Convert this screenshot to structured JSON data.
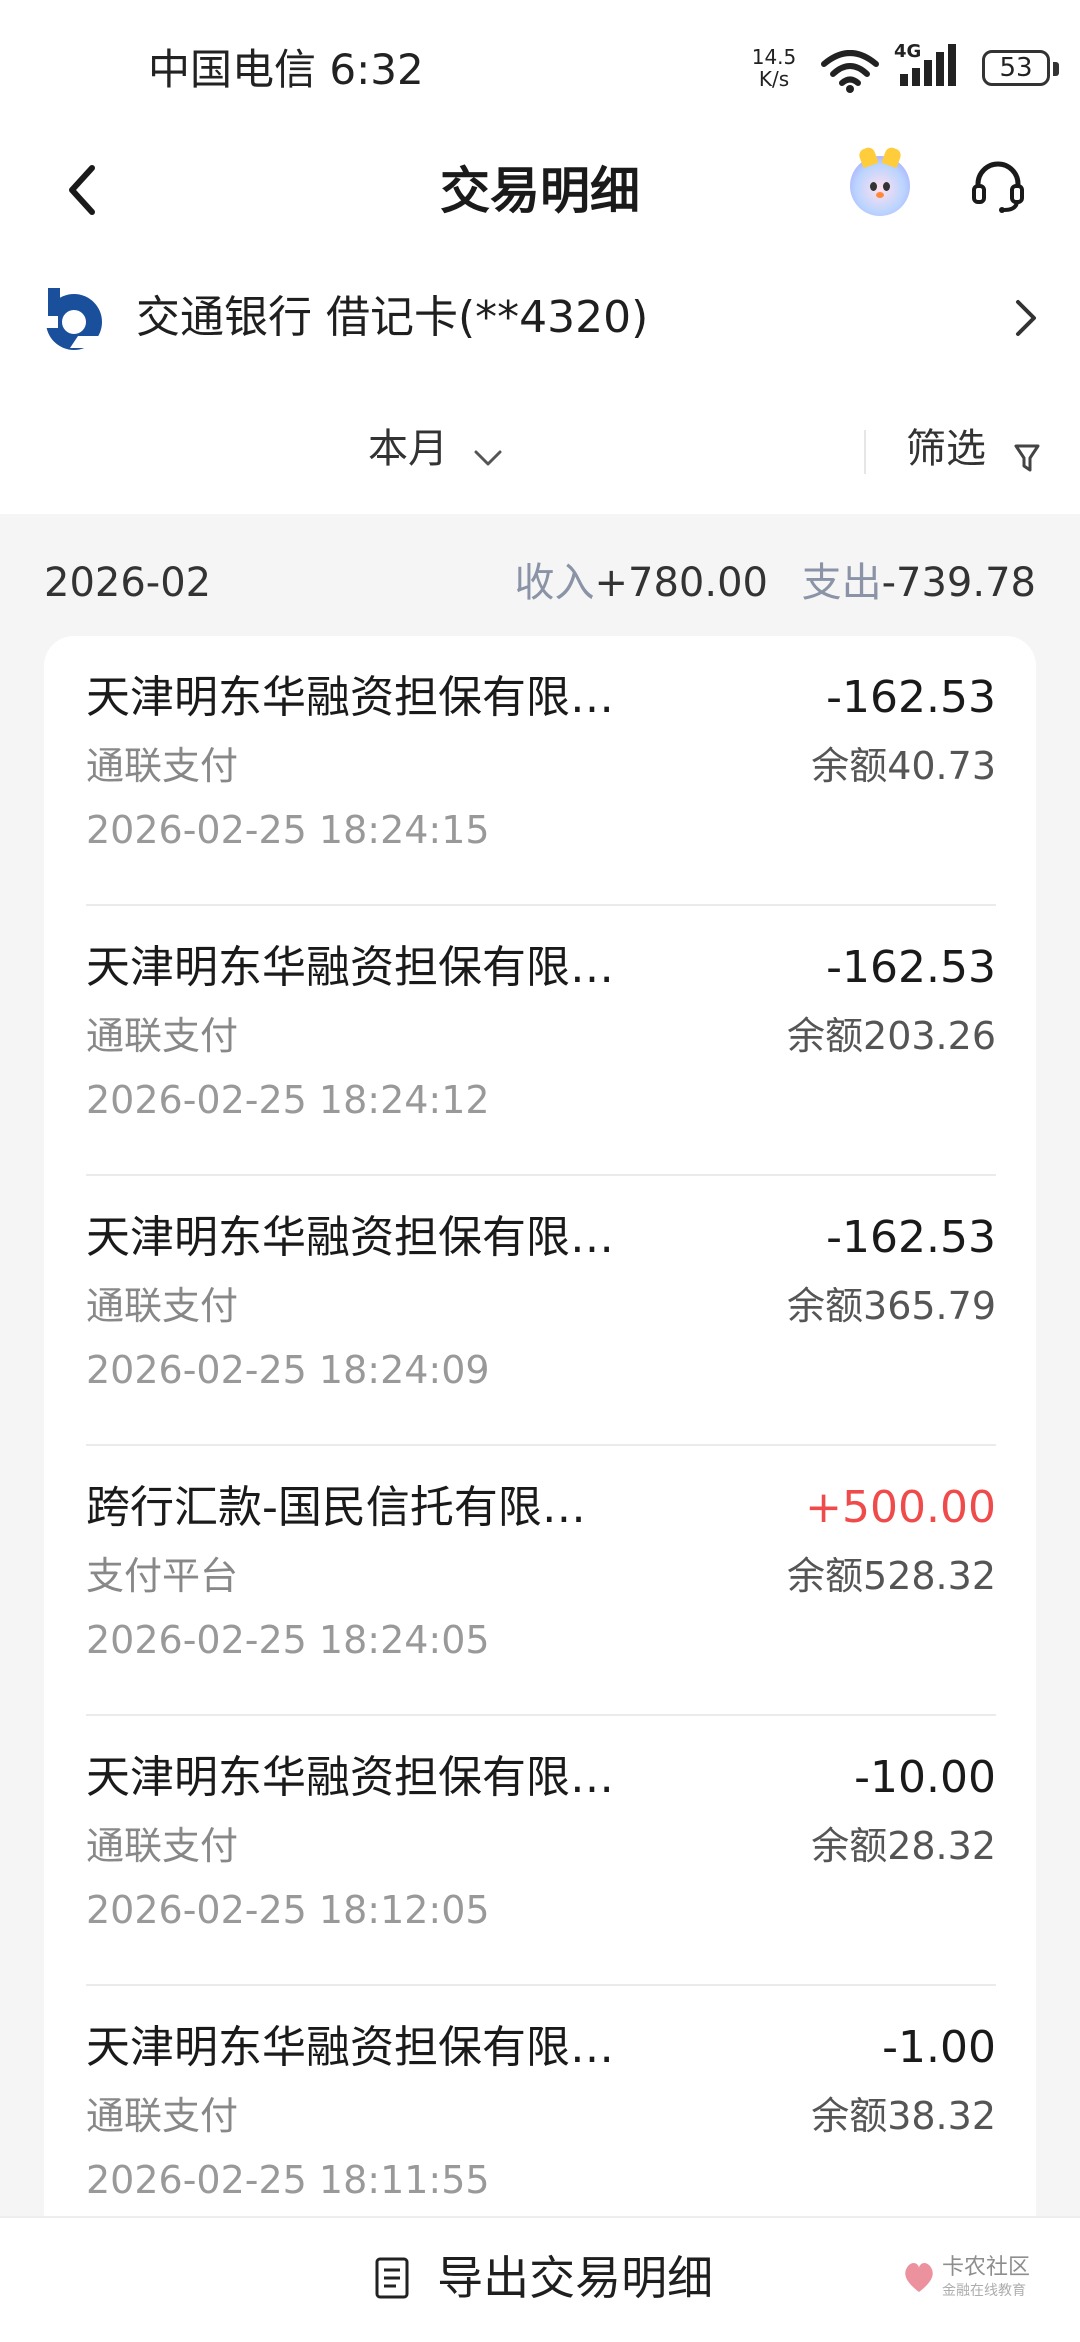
{
  "status_bar": {
    "carrier_time": "中国电信 6:32",
    "net_speed_value": "14.5",
    "net_speed_unit": "K/s",
    "signal_label": "4G",
    "battery": "53"
  },
  "header": {
    "title": "交易明细",
    "back_icon": "chevron-left-icon",
    "service_icon": "headset-icon"
  },
  "card": {
    "name": "交通银行 借记卡(**4320)",
    "brand_color": "#1a4f9c"
  },
  "filter": {
    "period": "本月",
    "filter_label": "筛选"
  },
  "summary": {
    "month": "2026-02",
    "income_label": "收入",
    "income_value": "+780.00",
    "expense_label": "支出",
    "expense_value": "-739.78"
  },
  "transactions": [
    {
      "desc": "天津明东华融资担保有限…",
      "amount": "-162.53",
      "channel": "通联支付",
      "balance": "余额40.73",
      "time": "2026-02-25 18:24:15"
    },
    {
      "desc": "天津明东华融资担保有限…",
      "amount": "-162.53",
      "channel": "通联支付",
      "balance": "余额203.26",
      "time": "2026-02-25 18:24:12"
    },
    {
      "desc": "天津明东华融资担保有限…",
      "amount": "-162.53",
      "channel": "通联支付",
      "balance": "余额365.79",
      "time": "2026-02-25 18:24:09"
    },
    {
      "desc": "跨行汇款-国民信托有限…",
      "amount": "+500.00",
      "channel": "支付平台",
      "balance": "余额528.32",
      "time": "2026-02-25 18:24:05"
    },
    {
      "desc": "天津明东华融资担保有限…",
      "amount": "-10.00",
      "channel": "通联支付",
      "balance": "余额28.32",
      "time": "2026-02-25 18:12:05"
    },
    {
      "desc": "天津明东华融资担保有限…",
      "amount": "-1.00",
      "channel": "通联支付",
      "balance": "余额38.32",
      "time": "2026-02-25 18:11:55"
    }
  ],
  "colors": {
    "positive_amount": "#ef4b4b",
    "secondary_text": "#8a94a6"
  },
  "bottom": {
    "export_label": "导出交易明细",
    "watermark_title": "卡农社区",
    "watermark_sub": "金融在线教育"
  }
}
